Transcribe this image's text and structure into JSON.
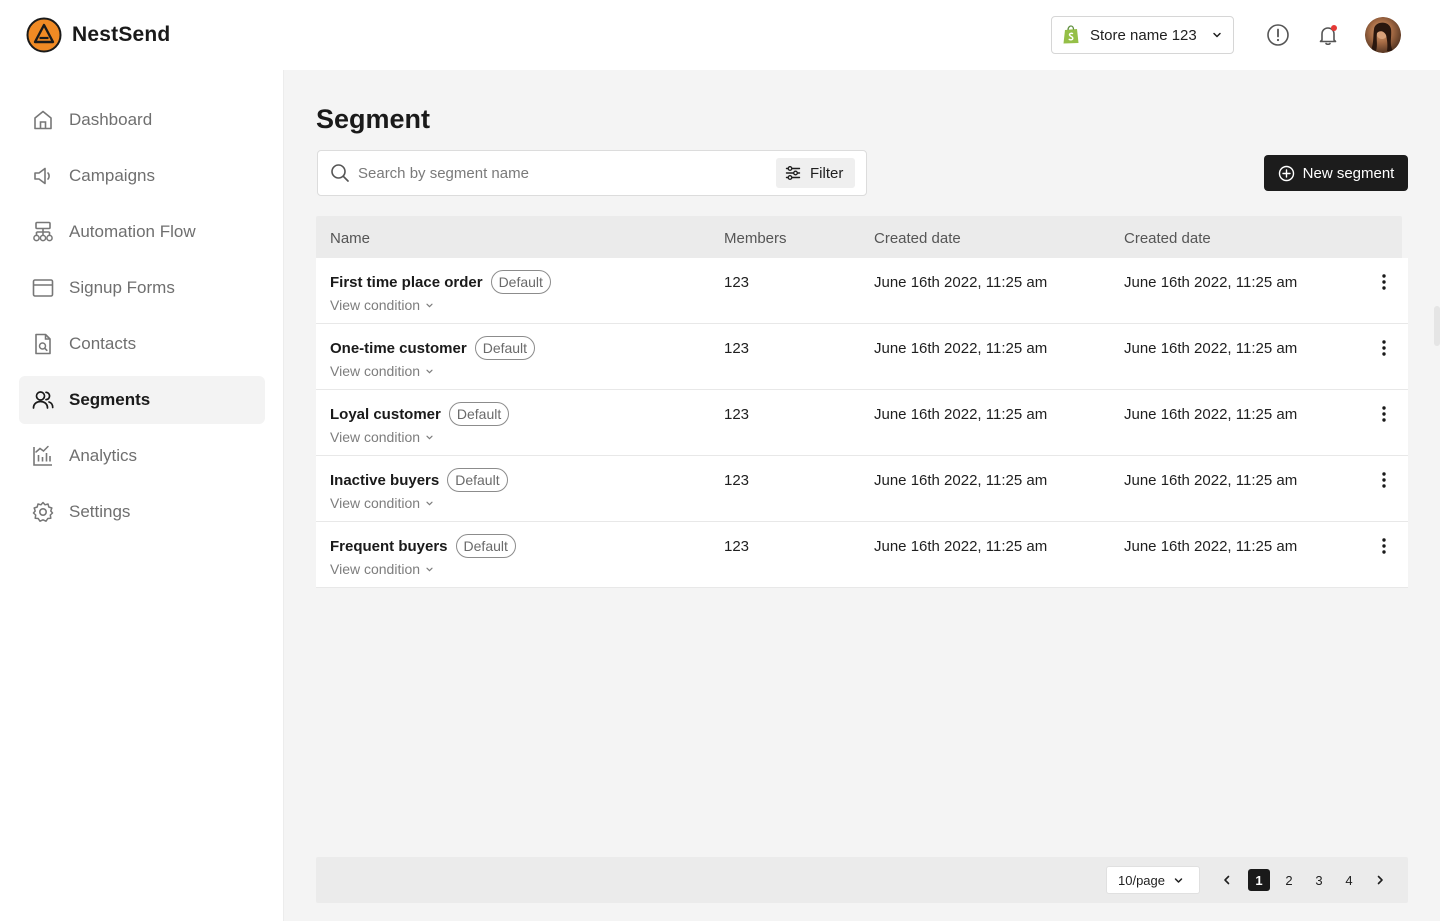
{
  "brand": {
    "name": "NestSend",
    "logo_icon": "nestsend-logo-icon",
    "accent": "#f08a24"
  },
  "header": {
    "store": {
      "name": "Store name 123",
      "icon": "shopify-bag-icon"
    },
    "icons": [
      "info-icon",
      "bell-icon"
    ],
    "notification_dot_color": "#e53935"
  },
  "sidebar": {
    "items": [
      {
        "label": "Dashboard",
        "icon": "home-icon"
      },
      {
        "label": "Campaigns",
        "icon": "megaphone-icon"
      },
      {
        "label": "Automation Flow",
        "icon": "flow-icon"
      },
      {
        "label": "Signup Forms",
        "icon": "form-window-icon"
      },
      {
        "label": "Contacts",
        "icon": "contact-file-icon"
      },
      {
        "label": "Segments",
        "icon": "users-icon",
        "active": true
      },
      {
        "label": "Analytics",
        "icon": "analytics-icon"
      },
      {
        "label": "Settings",
        "icon": "gear-icon"
      }
    ]
  },
  "main": {
    "title": "Segment",
    "search": {
      "placeholder": "Search by segment name"
    },
    "filter_label": "Filter",
    "new_button_label": "New segment",
    "table": {
      "columns": [
        "Name",
        "Members",
        "Created date",
        "Created date"
      ],
      "view_condition_label": "View condition",
      "rows": [
        {
          "name": "First time place order",
          "badge": "Default",
          "members": "123",
          "created": "June 16th 2022, 11:25 am",
          "created2": "June 16th 2022, 11:25 am"
        },
        {
          "name": "One-time customer",
          "badge": "Default",
          "members": "123",
          "created": "June 16th 2022, 11:25 am",
          "created2": "June 16th 2022, 11:25 am"
        },
        {
          "name": "Loyal customer",
          "badge": "Default",
          "members": "123",
          "created": "June 16th 2022, 11:25 am",
          "created2": "June 16th 2022, 11:25 am"
        },
        {
          "name": "Inactive buyers",
          "badge": "Default",
          "members": "123",
          "created": "June 16th 2022, 11:25 am",
          "created2": "June 16th 2022, 11:25 am"
        },
        {
          "name": "Frequent buyers",
          "badge": "Default",
          "members": "123",
          "created": "June 16th 2022, 11:25 am",
          "created2": "June 16th 2022, 11:25 am"
        }
      ]
    },
    "pagination": {
      "per_page": "10/page",
      "pages": [
        "1",
        "2",
        "3",
        "4"
      ],
      "current": "1"
    }
  }
}
